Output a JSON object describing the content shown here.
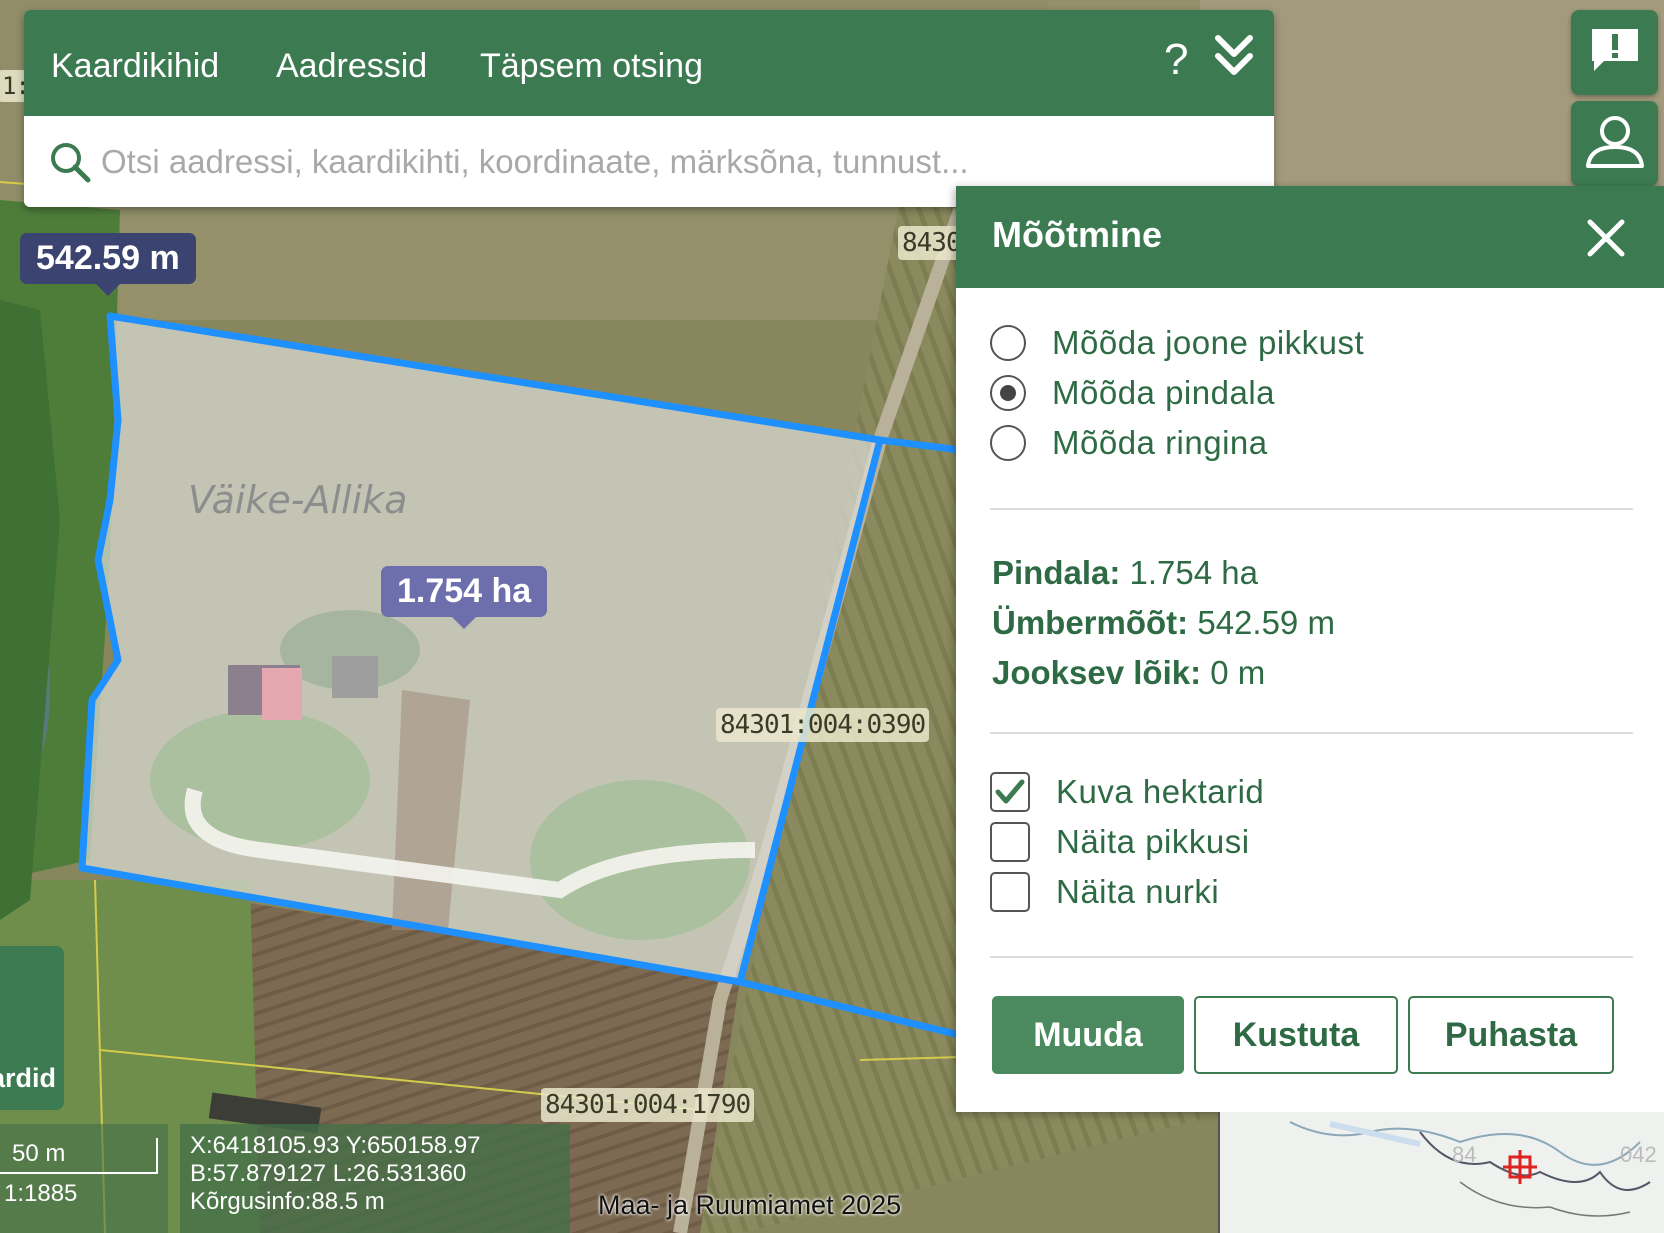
{
  "map": {
    "place_name": "Väike-Allika",
    "parcel_labels": [
      "84301:004:0390",
      "84301:004:1790",
      "8430"
    ],
    "edge_label": "1:",
    "measure_tooltips": {
      "perimeter": "542.59 m",
      "area": "1.754 ha"
    },
    "overview_labels": [
      "84",
      "042"
    ]
  },
  "top_panel": {
    "tabs": [
      "Kaardikihid",
      "Aadressid",
      "Täpsem otsing"
    ],
    "help_label": "?",
    "search_placeholder": "Otsi aadressi, kaardikihti, koordinaate, märksõna, tunnust..."
  },
  "measure_panel": {
    "title": "Mõõtmine",
    "modes": [
      {
        "label": "Mõõda joone pikkust",
        "selected": false
      },
      {
        "label": "Mõõda pindala",
        "selected": true
      },
      {
        "label": "Mõõda ringina",
        "selected": false
      }
    ],
    "stats": [
      {
        "label": "Pindala:",
        "value": "1.754 ha"
      },
      {
        "label": "Ümbermõõt:",
        "value": "542.59 m"
      },
      {
        "label": "Jooksev lõik:",
        "value": "0 m"
      }
    ],
    "options": [
      {
        "label": "Kuva hektarid",
        "checked": true
      },
      {
        "label": "Näita pikkusi",
        "checked": false
      },
      {
        "label": "Näita nurki",
        "checked": false
      }
    ],
    "buttons": {
      "edit": "Muuda",
      "delete": "Kustuta",
      "clear": "Puhasta"
    }
  },
  "bottom": {
    "layers_button_label": "ardid",
    "scale_distance": "50 m",
    "scale_ratio": "1:1885",
    "coords": {
      "xy": "X:6418105.93 Y:650158.97",
      "bl": "B:57.879127 L:26.531360",
      "height": "Kõrgusinfo:88.5 m"
    },
    "attribution": "Maa- ja Ruumiamet 2025"
  },
  "colors": {
    "brand_green": "#3c7a51",
    "measure_line": "#1e90ff",
    "tooltip_dark": "#3b4470",
    "tooltip_light": "#6c6fab"
  }
}
